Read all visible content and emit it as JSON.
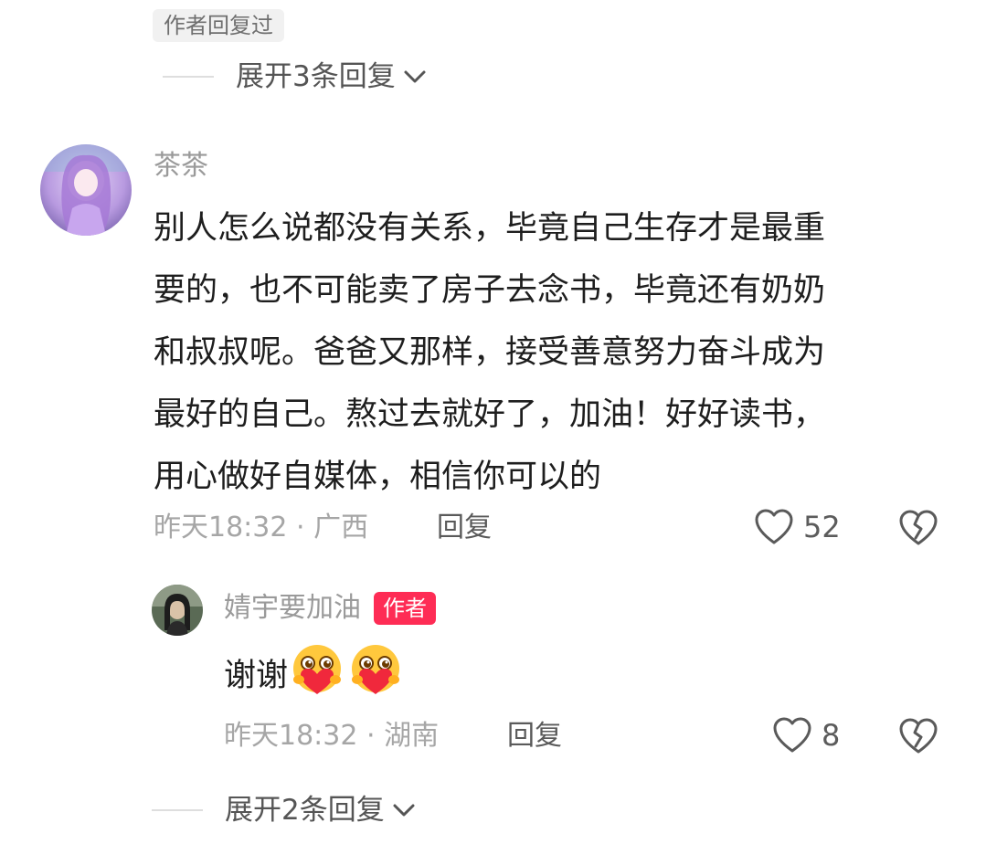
{
  "top": {
    "author_replied_chip": "作者回复过",
    "expand_label": "展开3条回复"
  },
  "comment": {
    "username": "茶茶",
    "lines": [
      "别人怎么说都没有关系，毕竟自己生存才是最重",
      "要的，也不可能卖了房子去念书，毕竟还有奶奶",
      "和叔叔呢。爸爸又那样，接受善意努力奋斗成为",
      "最好的自己。熬过去就好了，加油！好好读书，",
      "用心做好自媒体，相信你可以的"
    ],
    "meta": "昨天18:32 · 广西",
    "reply_label": "回复",
    "like_count": "52"
  },
  "reply": {
    "username": "婧宇要加油",
    "badge": "作者",
    "text": "谢谢",
    "emoji_count_label": "",
    "meta": "昨天18:32 · 湖南",
    "reply_label": "回复",
    "like_count": "8"
  },
  "bottom": {
    "expand_label": "展开2条回复"
  },
  "colors": {
    "badge": "#fe2c55",
    "muted": "#a6a6a6",
    "chip_bg": "#f1f1f1"
  }
}
